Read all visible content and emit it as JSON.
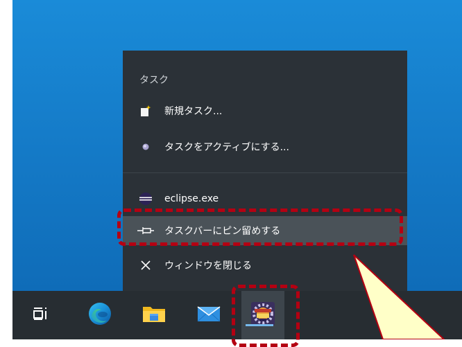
{
  "jumplist": {
    "header": "タスク",
    "items": [
      {
        "label": "新規タスク...",
        "icon": "new-task-icon"
      },
      {
        "label": "タスクをアクティブにする...",
        "icon": "activate-task-icon"
      },
      {
        "label": "eclipse.exe",
        "icon": "eclipse-icon"
      },
      {
        "label": "タスクバーにピン留めする",
        "icon": "pin-icon"
      },
      {
        "label": "ウィンドウを閉じる",
        "icon": "close-icon"
      }
    ]
  },
  "taskbar": {
    "buttons": [
      {
        "name": "task-view",
        "icon": "task-view-icon"
      },
      {
        "name": "edge",
        "icon": "edge-icon"
      },
      {
        "name": "file-explorer",
        "icon": "folder-icon"
      },
      {
        "name": "mail",
        "icon": "mail-icon"
      },
      {
        "name": "pleiades-eclipse",
        "icon": "pleiades-icon",
        "active": true
      }
    ]
  },
  "colors": {
    "desktop": "#1479c6",
    "jumplist_bg": "#2b3137",
    "taskbar_bg": "#272d32",
    "highlight": "#b40012",
    "callout_fill": "#ffffc8"
  }
}
